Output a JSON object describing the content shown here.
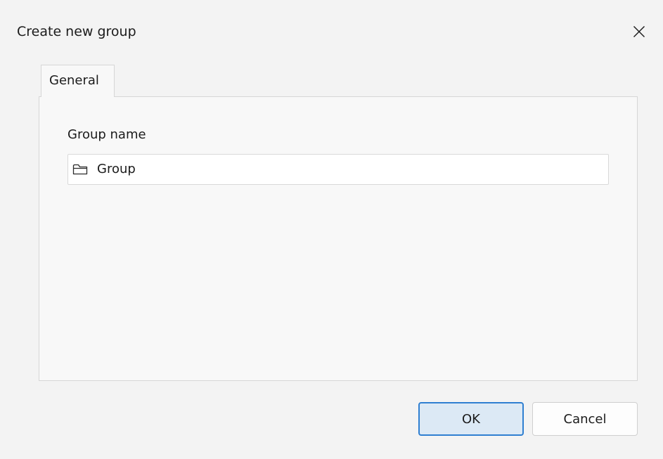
{
  "dialog": {
    "title": "Create new group",
    "close_icon": "close-icon"
  },
  "tabs": [
    {
      "label": "General",
      "selected": true
    }
  ],
  "general": {
    "group_name_label": "Group name",
    "group_name_value": "Group",
    "group_name_icon": "folder-icon"
  },
  "buttons": {
    "ok_label": "OK",
    "cancel_label": "Cancel"
  },
  "colors": {
    "accent": "#2f7fd1",
    "ok_background": "#dce9f5",
    "window_background": "#f3f3f3"
  }
}
